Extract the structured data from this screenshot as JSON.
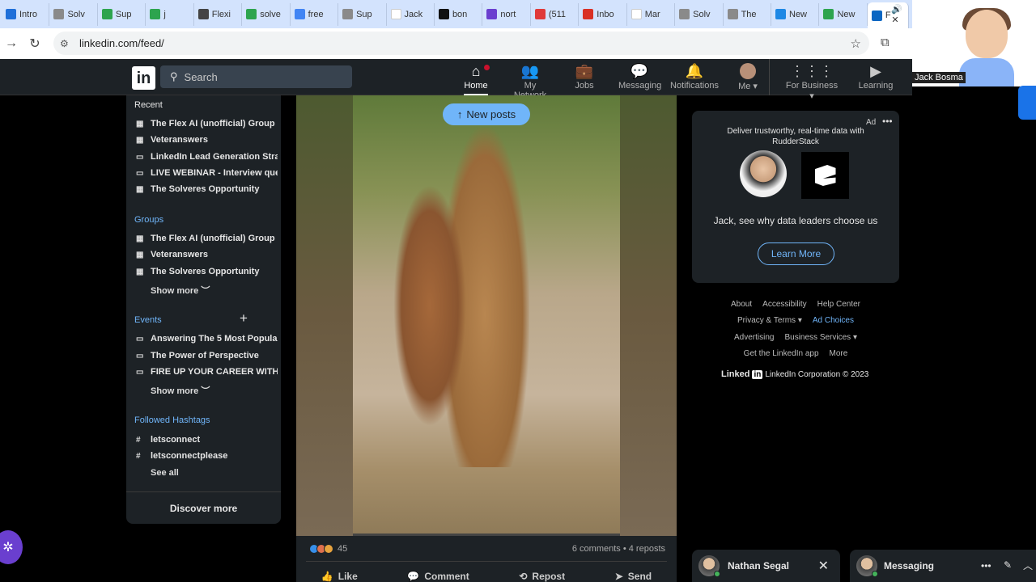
{
  "browser": {
    "tabs": [
      {
        "label": "Intro",
        "color": "#1e6fd9"
      },
      {
        "label": "Solv",
        "color": "#8a8a8a"
      },
      {
        "label": "Sup",
        "color": "#2da44e"
      },
      {
        "label": "j",
        "color": "#2da44e"
      },
      {
        "label": "Flexi",
        "color": "#444444"
      },
      {
        "label": "solve",
        "color": "#2da44e"
      },
      {
        "label": "free",
        "color": "#4285f4"
      },
      {
        "label": "Sup",
        "color": "#8a8a8a"
      },
      {
        "label": "Jack",
        "color": "#ffffff"
      },
      {
        "label": "bon",
        "color": "#111111"
      },
      {
        "label": "nort",
        "color": "#6a3fcf"
      },
      {
        "label": "(511",
        "color": "#e03a3a"
      },
      {
        "label": "Inbo",
        "color": "#d93025"
      },
      {
        "label": "Mar",
        "color": "#ffffff"
      },
      {
        "label": "Solv",
        "color": "#8a8a8a"
      },
      {
        "label": "The",
        "color": "#8a8a8a"
      },
      {
        "label": "New",
        "color": "#1e88e5"
      },
      {
        "label": "New",
        "color": "#2da44e"
      },
      {
        "label": "F",
        "color": "#0a66c2"
      }
    ],
    "url": "linkedin.com/feed/"
  },
  "webcam": {
    "name": "Jack Bosma"
  },
  "nav": {
    "search_placeholder": "Search",
    "items": [
      {
        "label": "Home",
        "icon": "home-icon"
      },
      {
        "label": "My Network",
        "icon": "network-icon"
      },
      {
        "label": "Jobs",
        "icon": "briefcase-icon"
      },
      {
        "label": "Messaging",
        "icon": "chat-icon"
      },
      {
        "label": "Notifications",
        "icon": "bell-icon"
      },
      {
        "label": "Me",
        "icon": "avatar"
      },
      {
        "label": "For Business",
        "icon": "grid-icon"
      },
      {
        "label": "Learning",
        "icon": "play-icon"
      }
    ]
  },
  "left": {
    "recent_title": "Recent",
    "recent": [
      "The Flex AI (unofficial) Group",
      "Veteranswers",
      "LinkedIn Lead Generation Stra...",
      "LIVE WEBINAR - Interview que...",
      "The Solveres Opportunity"
    ],
    "groups_title": "Groups",
    "groups": [
      "The Flex AI (unofficial) Group",
      "Veteranswers",
      "The Solveres Opportunity"
    ],
    "show_more": "Show more",
    "events_title": "Events",
    "events": [
      "Answering The 5 Most Popular...",
      "The Power of Perspective",
      "FIRE UP YOUR CAREER WITH ..."
    ],
    "hashtags_title": "Followed Hashtags",
    "hashtags": [
      "letsconnect",
      "letsconnectplease"
    ],
    "see_all": "See all",
    "discover": "Discover more"
  },
  "post": {
    "new_posts": "New posts",
    "reaction_count": "45",
    "counts": "6 comments • 4 reposts",
    "actions": [
      "Like",
      "Comment",
      "Repost",
      "Send"
    ]
  },
  "ad": {
    "label": "Ad",
    "tagline": "Deliver trustworthy, real-time data with RudderStack",
    "message": "Jack, see why data leaders choose us",
    "cta": "Learn More"
  },
  "footer": {
    "row1": [
      "About",
      "Accessibility",
      "Help Center"
    ],
    "row2a": "Privacy & Terms",
    "row2b": "Ad Choices",
    "row3a": "Advertising",
    "row3b": "Business Services",
    "row4": [
      "Get the LinkedIn app",
      "More"
    ],
    "brand_text": "Linked",
    "brand_in": "in",
    "copyright": "LinkedIn Corporation © 2023"
  },
  "chat": {
    "contact": "Nathan Segal",
    "messaging": "Messaging"
  }
}
